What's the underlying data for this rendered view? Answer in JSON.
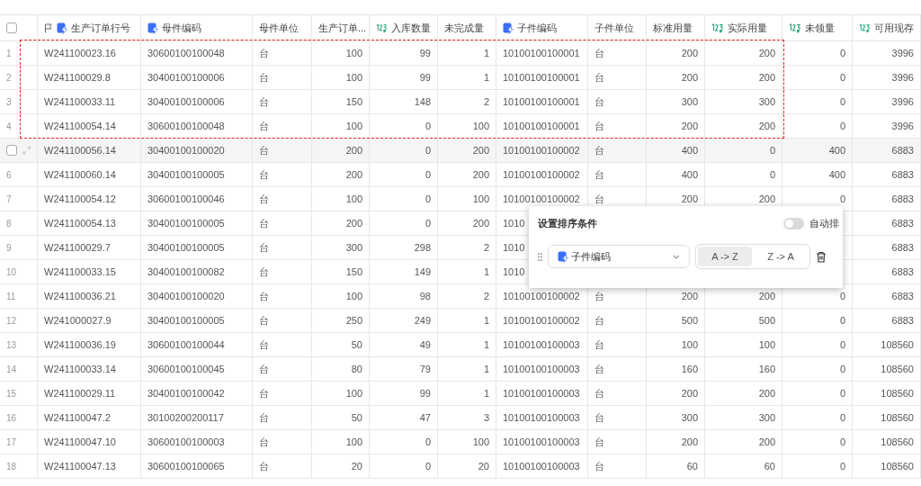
{
  "table": {
    "select_all": {
      "checked": false
    },
    "columns": [
      "生产订单行号",
      "母件编码",
      "母件单位",
      "生产订单...",
      "入库数量",
      "未完成量",
      "子件编码",
      "子件单位",
      "标准用量",
      "实际用量",
      "未领量",
      "可用现存"
    ],
    "rows": [
      {
        "index": "1",
        "selected": true,
        "hovered": false,
        "cells": [
          "W241100023.16",
          "30600100100048",
          "台",
          "100",
          "99",
          "1",
          "10100100100001",
          "台",
          "200",
          "200",
          "0",
          "3996"
        ]
      },
      {
        "index": "2",
        "selected": true,
        "hovered": false,
        "cells": [
          "W241100029.8",
          "30400100100006",
          "台",
          "100",
          "99",
          "1",
          "10100100100001",
          "台",
          "200",
          "200",
          "0",
          "3996"
        ]
      },
      {
        "index": "3",
        "selected": true,
        "hovered": false,
        "cells": [
          "W241100033.11",
          "30400100100006",
          "台",
          "150",
          "148",
          "2",
          "10100100100001",
          "台",
          "300",
          "300",
          "0",
          "3996"
        ]
      },
      {
        "index": "4",
        "selected": true,
        "hovered": false,
        "cells": [
          "W241100054.14",
          "30600100100048",
          "台",
          "100",
          "0",
          "100",
          "10100100100001",
          "台",
          "200",
          "200",
          "0",
          "3996"
        ]
      },
      {
        "selected": false,
        "hovered": true,
        "checked": false,
        "cells": [
          "W241100056.14",
          "30400100100020",
          "台",
          "200",
          "0",
          "200",
          "10100100100002",
          "台",
          "400",
          "0",
          "400",
          "6883"
        ]
      },
      {
        "index": "6",
        "selected": false,
        "hovered": false,
        "cells": [
          "W241100060.14",
          "30400100100005",
          "台",
          "200",
          "0",
          "200",
          "10100100100002",
          "台",
          "400",
          "0",
          "400",
          "6883"
        ]
      },
      {
        "index": "7",
        "selected": false,
        "hovered": false,
        "cells": [
          "W241100054.12",
          "30600100100046",
          "台",
          "100",
          "0",
          "100",
          "10100100100002",
          "台",
          "200",
          "200",
          "0",
          "6883"
        ]
      },
      {
        "index": "8",
        "selected": false,
        "hovered": false,
        "cells": [
          "W241100054.13",
          "30400100100005",
          "台",
          "200",
          "0",
          "200",
          "1010"
        ],
        "trailing_cells": [
          "6883"
        ]
      },
      {
        "index": "9",
        "selected": false,
        "hovered": false,
        "cells": [
          "W241100029.7",
          "30400100100005",
          "台",
          "300",
          "298",
          "2",
          "1010"
        ],
        "trailing_cells": [
          "6883"
        ]
      },
      {
        "index": "10",
        "selected": false,
        "hovered": false,
        "cells": [
          "W241100033.15",
          "30400100100082",
          "台",
          "150",
          "149",
          "1",
          "1010"
        ],
        "trailing_cells": [
          "6883"
        ]
      },
      {
        "index": "11",
        "selected": false,
        "hovered": false,
        "cells": [
          "W241100036.21",
          "30400100100020",
          "台",
          "100",
          "98",
          "2",
          "10100100100002",
          "台",
          "200",
          "200",
          "0",
          "6883"
        ]
      },
      {
        "index": "12",
        "selected": false,
        "hovered": false,
        "cells": [
          "W241000027.9",
          "30400100100005",
          "台",
          "250",
          "249",
          "1",
          "10100100100002",
          "台",
          "500",
          "500",
          "0",
          "6883"
        ]
      },
      {
        "index": "13",
        "selected": false,
        "hovered": false,
        "cells": [
          "W241100036.19",
          "30600100100044",
          "台",
          "50",
          "49",
          "1",
          "10100100100003",
          "台",
          "100",
          "100",
          "0",
          "108560"
        ]
      },
      {
        "index": "14",
        "selected": false,
        "hovered": false,
        "cells": [
          "W241100033.14",
          "30600100100045",
          "台",
          "80",
          "79",
          "1",
          "10100100100003",
          "台",
          "160",
          "160",
          "0",
          "108560"
        ]
      },
      {
        "index": "15",
        "selected": false,
        "hovered": false,
        "cells": [
          "W241100029.11",
          "30400100100042",
          "台",
          "100",
          "99",
          "1",
          "10100100100003",
          "台",
          "200",
          "200",
          "0",
          "108560"
        ]
      },
      {
        "index": "16",
        "selected": false,
        "hovered": false,
        "cells": [
          "W241100047.2",
          "30100200200117",
          "台",
          "50",
          "47",
          "3",
          "10100100100003",
          "台",
          "300",
          "300",
          "0",
          "108560"
        ]
      },
      {
        "index": "17",
        "selected": false,
        "hovered": false,
        "cells": [
          "W241100047.10",
          "30600100100003",
          "台",
          "100",
          "0",
          "100",
          "10100100100003",
          "台",
          "200",
          "200",
          "0",
          "108560"
        ]
      },
      {
        "index": "18",
        "selected": false,
        "hovered": false,
        "cells": [
          "W241100047.13",
          "30600100100065",
          "台",
          "20",
          "0",
          "20",
          "10100100100003",
          "台",
          "60",
          "60",
          "0",
          "108560"
        ]
      }
    ]
  },
  "sort_panel": {
    "title": "设置排序条件",
    "auto_sort": {
      "label": "自动排",
      "on": false
    },
    "field": {
      "value": "子件编码"
    },
    "directions": [
      {
        "label": "A -> Z",
        "selected": true
      },
      {
        "label": "Z -> A",
        "selected": false
      }
    ]
  }
}
